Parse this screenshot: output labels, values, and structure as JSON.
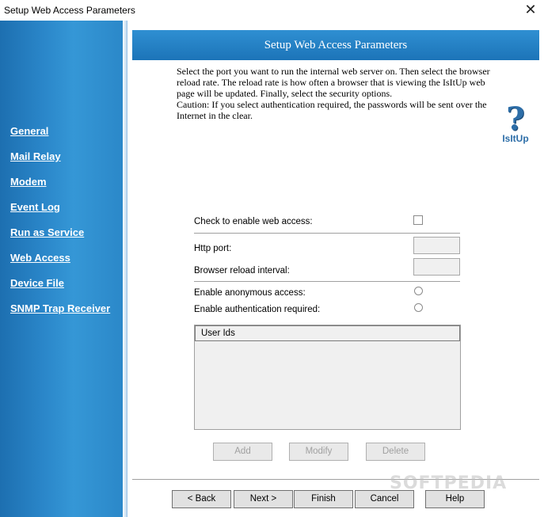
{
  "window": {
    "title": "Setup Web Access Parameters",
    "close_glyph": "✕"
  },
  "sidebar": {
    "items": [
      {
        "label": "General"
      },
      {
        "label": "Mail Relay"
      },
      {
        "label": "Modem"
      },
      {
        "label": "Event Log"
      },
      {
        "label": "Run as Service"
      },
      {
        "label": "Web Access"
      },
      {
        "label": "Device File"
      },
      {
        "label": "SNMP Trap Receiver"
      }
    ]
  },
  "header": {
    "title": "Setup Web Access Parameters"
  },
  "description": {
    "paragraph": "Select the port you want to run the internal web server on. Then select the browser reload rate. The reload rate is how often a browser that is viewing the IsItUp web page will be updated. Finally, select the security options.",
    "caution": "Caution: If you select authentication required, the passwords will be sent over the Internet in the clear."
  },
  "logo": {
    "glyph": "?",
    "label": "IsItUp"
  },
  "form": {
    "enable_web_access_label": "Check to enable web access:",
    "http_port_label": "Http port:",
    "http_port_value": "",
    "reload_interval_label": "Browser reload interval:",
    "reload_interval_value": "",
    "anonymous_label": "Enable anonymous access:",
    "authentication_label": "Enable authentication required:"
  },
  "user_list": {
    "header": "User Ids",
    "rows": []
  },
  "list_buttons": {
    "add": "Add",
    "modify": "Modify",
    "delete": "Delete"
  },
  "wizard_buttons": {
    "back": "< Back",
    "next": "Next >",
    "finish": "Finish",
    "cancel": "Cancel",
    "help": "Help"
  },
  "watermark": "SOFTPEDIA",
  "colors": {
    "sidebar": "#2a86c9",
    "banner": "#1f78bd",
    "logo": "#2d6ea8"
  }
}
